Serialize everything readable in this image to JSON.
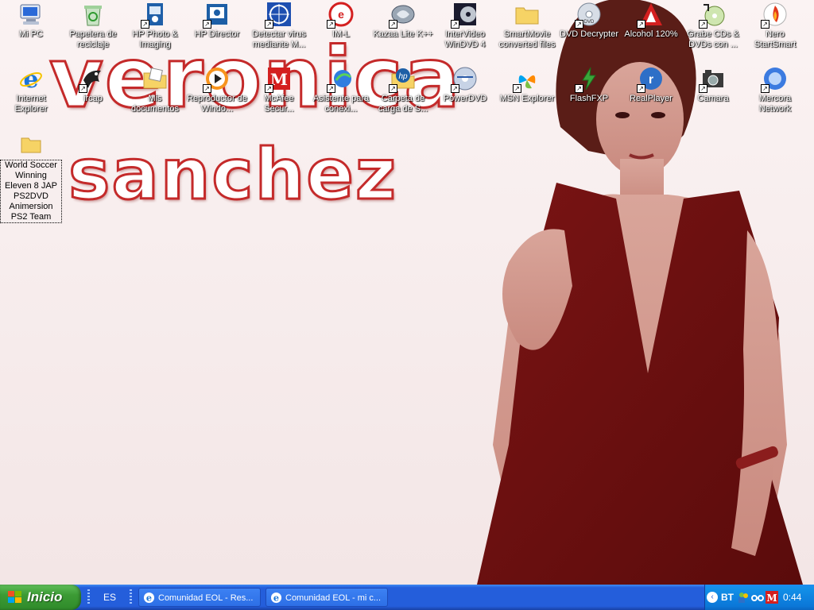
{
  "wallpaper": {
    "line1": "veronica",
    "line2": "sanchez"
  },
  "icons": [
    {
      "label": "Mi PC",
      "name": "my-computer-icon"
    },
    {
      "label": "Papelera de reciclaje",
      "name": "recycle-bin-icon"
    },
    {
      "label": "HP Photo & Imaging",
      "name": "hp-photo-imaging-icon"
    },
    {
      "label": "HP Director",
      "name": "hp-director-icon"
    },
    {
      "label": "Detectar virus mediante M...",
      "name": "virus-scan-icon"
    },
    {
      "label": "IM-L",
      "name": "im-l-icon"
    },
    {
      "label": "Kazaa Lite K++",
      "name": "kazaa-icon"
    },
    {
      "label": "InterVideo WinDVD 4",
      "name": "windvd-icon"
    },
    {
      "label": "SmartMovie converted files",
      "name": "folder-icon"
    },
    {
      "label": "DVD Decrypter",
      "name": "dvd-decrypter-icon"
    },
    {
      "label": "Alcohol 120%",
      "name": "alcohol-icon"
    },
    {
      "label": "Grabe CDs & DVDs con ...",
      "name": "cd-burn-icon"
    },
    {
      "label": "Nero StartSmart",
      "name": "nero-icon"
    },
    {
      "label": "Internet Explorer",
      "name": "internet-explorer-icon"
    },
    {
      "label": "ircap",
      "name": "ircap-icon"
    },
    {
      "label": "Mis documentos",
      "name": "my-documents-icon"
    },
    {
      "label": "Reproductor de Windo...",
      "name": "media-player-icon"
    },
    {
      "label": "McAfee Secur...",
      "name": "mcafee-icon"
    },
    {
      "label": "Asistente para conexi...",
      "name": "connection-wizard-icon"
    },
    {
      "label": "Carpeta de carga de S...",
      "name": "hp-upload-folder-icon"
    },
    {
      "label": "PowerDVD",
      "name": "powerdvd-icon"
    },
    {
      "label": "MSN Explorer",
      "name": "msn-icon"
    },
    {
      "label": "FlashFXP",
      "name": "flashfxp-icon"
    },
    {
      "label": "RealPlayer",
      "name": "realplayer-icon"
    },
    {
      "label": "Camara",
      "name": "camera-icon"
    },
    {
      "label": "Mercora Network",
      "name": "mercora-icon"
    },
    {
      "label": "World Soccer Winning Eleven 8 JAP PS2DVD Animersion PS2 Team",
      "name": "folder-icon"
    }
  ],
  "taskbar": {
    "start_label": "Inicio",
    "language": "ES",
    "tasks": [
      {
        "label": "Comunidad EOL - Res..."
      },
      {
        "label": "Comunidad EOL - mi c..."
      }
    ],
    "tray": {
      "bt_label": "BT",
      "time": "0:44"
    }
  },
  "colors": {
    "wallpaper_accent": "#c42a2a",
    "taskbar_blue": "#245edb",
    "start_green": "#3c9b35"
  }
}
